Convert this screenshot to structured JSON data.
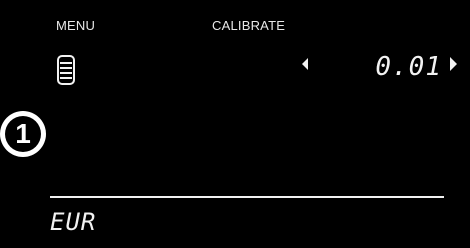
{
  "header": {
    "menu_label": "MENU",
    "mode_label": "CALIBRATE"
  },
  "main": {
    "value": "0.01",
    "currency": "EUR"
  },
  "annotation": {
    "step": "1"
  },
  "icons": {
    "coin_stack": "coin-stack-icon",
    "left": "left-arrow-icon",
    "right": "right-arrow-icon"
  },
  "colors": {
    "background": "#000000",
    "foreground": "#f2f2f2"
  }
}
